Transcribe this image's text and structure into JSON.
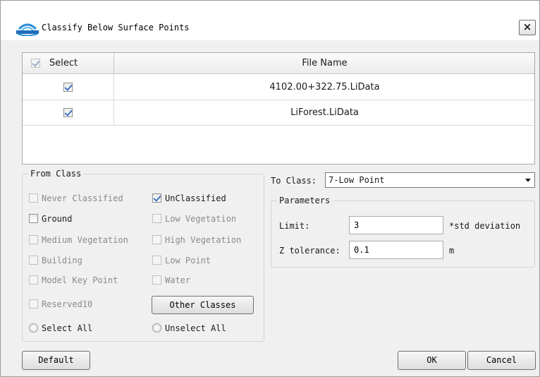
{
  "dialog": {
    "title": "Classify Below Surface Points",
    "close_symbol": "×",
    "icon": "lidar-app-logo-icon"
  },
  "table": {
    "columns": [
      "Select",
      "File Name"
    ],
    "header_checked": true,
    "rows": [
      {
        "checked": true,
        "file": "4102.00+322.75.LiData"
      },
      {
        "checked": true,
        "file": "LiForest.LiData"
      }
    ]
  },
  "from_class": {
    "title": "From Class",
    "items": [
      {
        "label": "Never Classified",
        "checked": false,
        "enabled": false
      },
      {
        "label": "UnClassified",
        "checked": true,
        "enabled": true
      },
      {
        "label": "Ground",
        "checked": false,
        "enabled": true
      },
      {
        "label": "Low Vegetation",
        "checked": false,
        "enabled": false
      },
      {
        "label": "Medium Vegetation",
        "checked": false,
        "enabled": false
      },
      {
        "label": "High Vegetation",
        "checked": false,
        "enabled": false
      },
      {
        "label": "Building",
        "checked": false,
        "enabled": false
      },
      {
        "label": "Low Point",
        "checked": false,
        "enabled": false
      },
      {
        "label": "Model Key Point",
        "checked": false,
        "enabled": false
      },
      {
        "label": "Water",
        "checked": false,
        "enabled": false
      },
      {
        "label": "Reserved10",
        "checked": false,
        "enabled": false
      }
    ],
    "other_classes_button": "Other Classes",
    "select_all": "Select All",
    "unselect_all": "Unselect All"
  },
  "to_class": {
    "label": "To Class:",
    "selected": "7-Low Point"
  },
  "parameters": {
    "title": "Parameters",
    "limit_label": "Limit:",
    "limit_value": "3",
    "limit_unit": "*std deviation",
    "z_tol_label": "Z tolerance:",
    "z_tol_value": "0.1",
    "z_tol_unit": "m"
  },
  "footer": {
    "default_button": "Default",
    "ok_button": "OK",
    "cancel_button": "Cancel"
  },
  "colors": {
    "check_mark": "#3c6fbf",
    "disabled_text": "#8a8a8a",
    "dialog_bg": "#f0f0f0"
  }
}
